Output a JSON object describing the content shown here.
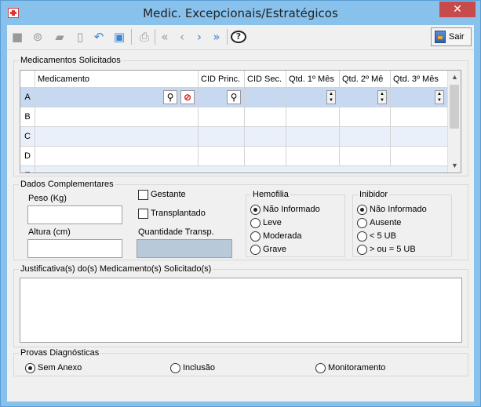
{
  "window": {
    "title": "Medic. Excepcionais/Estratégicos",
    "close_label": "✕"
  },
  "toolbar": {
    "icons": [
      "new-icon",
      "binoculars-icon",
      "eraser-icon",
      "trash-icon",
      "undo-icon",
      "save-icon",
      "print-icon",
      "first-icon",
      "prev-icon",
      "next-icon",
      "last-icon",
      "help-icon"
    ],
    "sair_label": "Sair"
  },
  "medicamentos": {
    "group_label": "Medicamentos Solicitados",
    "columns": [
      "Medicamento",
      "CID Princ.",
      "CID Sec.",
      "Qtd. 1º Mês",
      "Qtd. 2º Mê",
      "Qtd. 3º Mês"
    ],
    "rows": [
      "A",
      "B",
      "C",
      "D",
      "E"
    ]
  },
  "complementares": {
    "group_label": "Dados Complementares",
    "peso_label": "Peso (Kg)",
    "altura_label": "Altura (cm)",
    "gestante_label": "Gestante",
    "transplantado_label": "Transplantado",
    "qtd_transp_label": "Quantidade Transp.",
    "hemofilia": {
      "label": "Hemofilia",
      "options": [
        "Não Informado",
        "Leve",
        "Moderada",
        "Grave"
      ],
      "selected": "Não Informado"
    },
    "inibidor": {
      "label": "Inibidor",
      "options": [
        "Não Informado",
        "Ausente",
        "< 5 UB",
        "> ou = 5 UB"
      ],
      "selected": "Não Informado"
    }
  },
  "justificativa": {
    "group_label": "Justificativa(s) do(s) Medicamento(s) Solicitado(s)"
  },
  "provas": {
    "group_label": "Provas Diagnósticas",
    "options": [
      "Sem Anexo",
      "Inclusão",
      "Monitoramento"
    ],
    "selected": "Sem Anexo"
  },
  "colors": {
    "titlebar": "#87c1ec",
    "close": "#c74b4b",
    "selected_row": "#c6d9f1",
    "alt_row": "#e9f0fa",
    "readonly_field": "#b8c9da"
  }
}
